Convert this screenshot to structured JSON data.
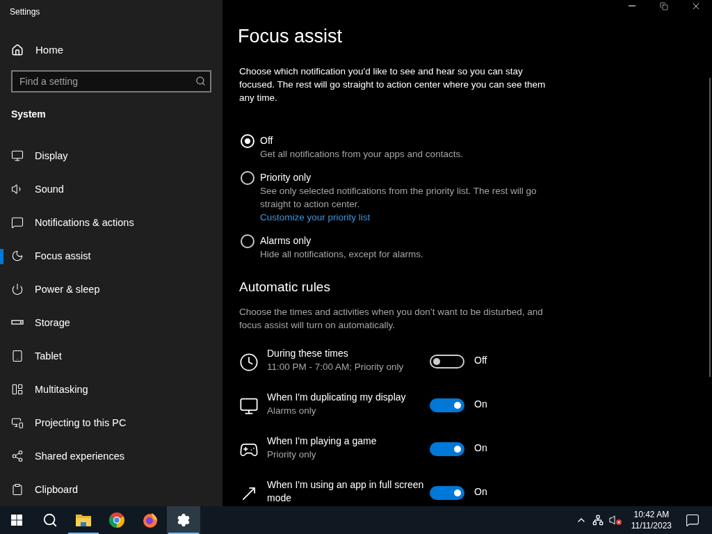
{
  "window": {
    "title": "Settings"
  },
  "sidebar": {
    "home": "Home",
    "search": {
      "placeholder": "Find a setting"
    },
    "section": "System",
    "items": [
      {
        "label": "Display",
        "selected": false
      },
      {
        "label": "Sound",
        "selected": false
      },
      {
        "label": "Notifications & actions",
        "selected": false
      },
      {
        "label": "Focus assist",
        "selected": true
      },
      {
        "label": "Power & sleep",
        "selected": false
      },
      {
        "label": "Storage",
        "selected": false
      },
      {
        "label": "Tablet",
        "selected": false
      },
      {
        "label": "Multitasking",
        "selected": false
      },
      {
        "label": "Projecting to this PC",
        "selected": false
      },
      {
        "label": "Shared experiences",
        "selected": false
      },
      {
        "label": "Clipboard",
        "selected": false
      }
    ]
  },
  "main": {
    "title": "Focus assist",
    "description": "Choose which notification you'd like to see and hear so you can stay focused. The rest will go straight to action center where you can see them any time.",
    "options": [
      {
        "label": "Off",
        "description": "Get all notifications from your apps and contacts.",
        "selected": true
      },
      {
        "label": "Priority only",
        "description": "See only selected notifications from the priority list. The rest will go straight to action center.",
        "link": "Customize your priority list",
        "selected": false
      },
      {
        "label": "Alarms only",
        "description": "Hide all notifications, except for alarms.",
        "selected": false
      }
    ],
    "rules_heading": "Automatic rules",
    "rules_description": "Choose the times and activities when you don’t want to be disturbed, and focus assist will turn on automatically.",
    "rules": [
      {
        "kind": "clock",
        "title": "During these times",
        "subtitle": "11:00 PM - 7:00 AM; Priority only",
        "on": false,
        "state_label": "Off"
      },
      {
        "kind": "display",
        "title": "When I'm duplicating my display",
        "subtitle": "Alarms only",
        "on": true,
        "state_label": "On"
      },
      {
        "kind": "game",
        "title": "When I'm playing a game",
        "subtitle": "Priority only",
        "on": true,
        "state_label": "On"
      },
      {
        "kind": "fullscreen",
        "title": "When I'm using an app in full screen mode",
        "on": true,
        "state_label": "On"
      }
    ]
  },
  "taskbar": {
    "apps": [
      {
        "kind": "start",
        "selected": false,
        "running": false
      },
      {
        "kind": "search",
        "selected": false,
        "running": false
      },
      {
        "kind": "folder",
        "selected": false,
        "running": true
      },
      {
        "kind": "chrome",
        "selected": false,
        "running": false
      },
      {
        "kind": "firefox",
        "selected": false,
        "running": false
      },
      {
        "kind": "settings",
        "selected": true,
        "running": true
      }
    ],
    "time": "10:42 AM",
    "date": "11/11/2023"
  }
}
